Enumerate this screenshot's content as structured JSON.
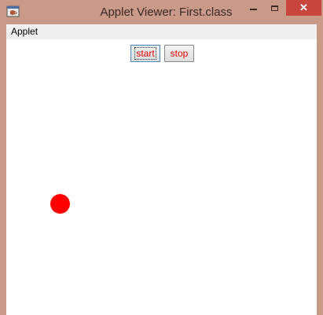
{
  "window": {
    "title": "Applet Viewer: First.class",
    "icon": "java-icon",
    "controls": {
      "minimize_icon": "minimize-icon",
      "maximize_icon": "maximize-icon",
      "close_label": "✕"
    }
  },
  "menubar": {
    "items": [
      {
        "label": "Applet"
      }
    ]
  },
  "applet": {
    "buttons": {
      "start_label": "start",
      "stop_label": "stop"
    },
    "ball": {
      "shape": "circle-icon",
      "color": "#ff0000"
    }
  },
  "colors": {
    "frame": "#c99a88",
    "close_button": "#c7473e",
    "button_text": "#e00000",
    "canvas": "#ffffff"
  }
}
